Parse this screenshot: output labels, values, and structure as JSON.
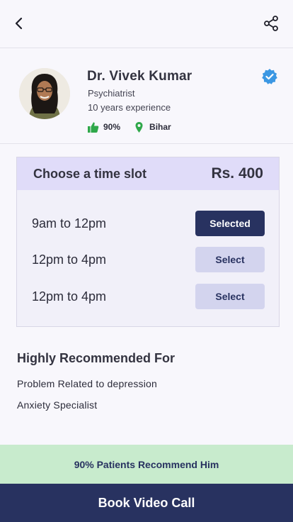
{
  "header": {
    "back_icon": "chevron-left-icon",
    "share_icon": "share-icon"
  },
  "doctor": {
    "name": "Dr. Vivek Kumar",
    "specialty": "Psychiatrist",
    "experience": "10 years experience",
    "rating": "90%",
    "location": "Bihar",
    "verified_icon": "verified-badge-icon",
    "colors": {
      "verified": "#3b97e3",
      "thumb": "#2fa84a",
      "pin": "#2fa84a"
    }
  },
  "slots": {
    "title": "Choose a time slot",
    "price": "Rs. 400",
    "items": [
      {
        "time": "9am to 12pm",
        "button": "Selected",
        "state": "selected"
      },
      {
        "time": "12pm to 4pm",
        "button": "Select",
        "state": "available"
      },
      {
        "time": "12pm to 4pm",
        "button": "Select",
        "state": "available"
      }
    ]
  },
  "recommended": {
    "title": "Highly Recommended For",
    "items": [
      "Problem Related to depression",
      "Anxiety Specialist"
    ]
  },
  "banner": {
    "text": "90% Patients Recommend Him"
  },
  "cta": {
    "label": "Book Video Call"
  },
  "colors": {
    "primary": "#283260",
    "slot_header": "#e0dcf9",
    "banner": "#c8ebcd",
    "unselected_button": "#d3d4ee"
  }
}
